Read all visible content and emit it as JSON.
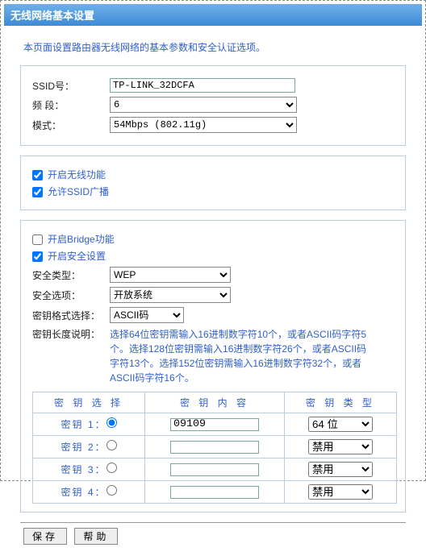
{
  "title": "无线网络基本设置",
  "desc": "本页面设置路由器无线网络的基本参数和安全认证选项。",
  "basic": {
    "ssid_label": "SSID号：",
    "ssid_value": "TP-LINK_32DCFA",
    "band_label": "频 段：",
    "band_value": "6",
    "mode_label": "模式：",
    "mode_value": "54Mbps (802.11g)"
  },
  "toggles": {
    "wifi_on": "开启无线功能",
    "ssid_bc": "允许SSID广播",
    "bridge": "开启Bridge功能",
    "security": "开启安全设置"
  },
  "sec": {
    "type_label": "安全类型：",
    "type_value": "WEP",
    "opt_label": "安全选项：",
    "opt_value": "开放系统",
    "fmt_label": "密钥格式选择：",
    "fmt_value": "ASCII码",
    "len_label": "密钥长度说明：",
    "len_text": "选择64位密钥需输入16进制数字符10个，或者ASCII码字符5个。选择128位密钥需输入16进制数字符26个，或者ASCII码字符13个。选择152位密钥需输入16进制数字符32个，或者ASCII码字符16个。"
  },
  "keytable": {
    "h_sel": "密 钥 选 择",
    "h_content": "密 钥 内 容",
    "h_type": "密 钥 类 型",
    "rows": [
      {
        "label": "密钥 1：",
        "value": "09109",
        "type": "64 位",
        "checked": true
      },
      {
        "label": "密钥 2：",
        "value": "",
        "type": "禁用",
        "checked": false
      },
      {
        "label": "密钥 3：",
        "value": "",
        "type": "禁用",
        "checked": false
      },
      {
        "label": "密钥 4：",
        "value": "",
        "type": "禁用",
        "checked": false
      }
    ]
  },
  "footer": {
    "save": "保存",
    "help": "帮助"
  }
}
